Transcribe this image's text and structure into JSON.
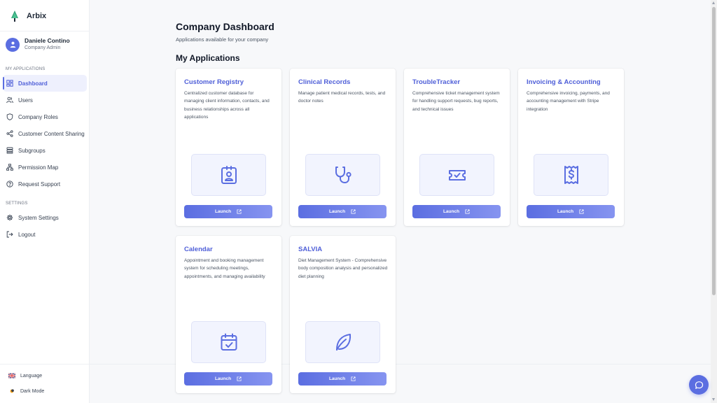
{
  "brand": {
    "name": "Arbix"
  },
  "user": {
    "name": "Daniele Contino",
    "role": "Company Admin"
  },
  "sidebar": {
    "section_apps": "MY APPLICATIONS",
    "section_settings": "SETTINGS",
    "items": [
      {
        "label": "Dashboard",
        "icon": "dashboard-icon"
      },
      {
        "label": "Users",
        "icon": "users-icon"
      },
      {
        "label": "Company Roles",
        "icon": "shield-icon"
      },
      {
        "label": "Customer Content Sharing",
        "icon": "share-icon"
      },
      {
        "label": "Subgroups",
        "icon": "layers-icon"
      },
      {
        "label": "Permission Map",
        "icon": "hierarchy-icon"
      },
      {
        "label": "Request Support",
        "icon": "help-icon"
      }
    ],
    "settings_items": [
      {
        "label": "System Settings",
        "icon": "gear-icon"
      },
      {
        "label": "Logout",
        "icon": "logout-icon"
      }
    ],
    "language_label": "Language",
    "dark_mode_label": "Dark Mode"
  },
  "page": {
    "title": "Company Dashboard",
    "subtitle": "Applications available for your company",
    "section_title": "My Applications"
  },
  "apps": [
    {
      "title": "Customer Registry",
      "description": "Centralized customer database for managing client information, contacts, and business relationships across all applications",
      "icon": "contact-card-icon",
      "launch_label": "Launch"
    },
    {
      "title": "Clinical Records",
      "description": "Manage patient medical records, tests, and doctor notes",
      "icon": "stethoscope-icon",
      "launch_label": "Launch"
    },
    {
      "title": "TroubleTracker",
      "description": "Comprehensive ticket management system for handling support requests, bug reports, and technical issues",
      "icon": "ticket-icon",
      "launch_label": "Launch"
    },
    {
      "title": "Invoicing & Accounting",
      "description": "Comprehensive invoicing, payments, and accounting management with Stripe integration",
      "icon": "receipt-dollar-icon",
      "launch_label": "Launch"
    },
    {
      "title": "Calendar",
      "description": "Appointment and booking management system for scheduling meetings, appointments, and managing availability",
      "icon": "calendar-check-icon",
      "launch_label": "Launch"
    },
    {
      "title": "SALVIA",
      "description": "Diet Management System - Comprehensive body composition analysis and personalized diet planning",
      "icon": "leaf-icon",
      "launch_label": "Launch"
    }
  ],
  "colors": {
    "accent": "#5b6ee1",
    "title_blue": "#4f5fd8"
  }
}
